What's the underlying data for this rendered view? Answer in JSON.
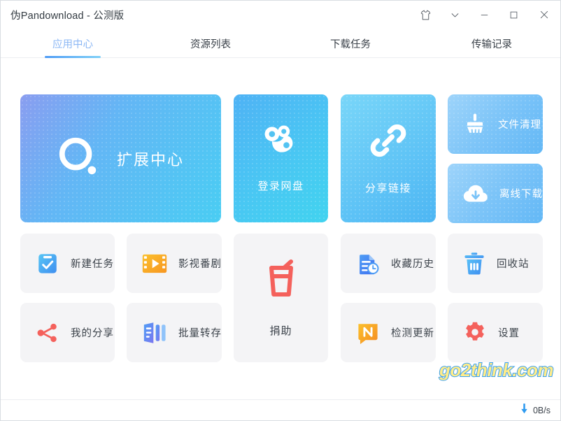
{
  "window": {
    "title": "伪Pandownload - 公测版",
    "controls": [
      {
        "name": "skin-icon",
        "label": "换肤"
      },
      {
        "name": "chevron-down-icon",
        "label": "更多"
      },
      {
        "name": "minimize-icon",
        "label": "最小化"
      },
      {
        "name": "maximize-icon",
        "label": "最大化"
      },
      {
        "name": "close-icon",
        "label": "关闭"
      }
    ]
  },
  "tabs": [
    {
      "label": "应用中心",
      "active": true
    },
    {
      "label": "资源列表",
      "active": false
    },
    {
      "label": "下载任务",
      "active": false
    },
    {
      "label": "传输记录",
      "active": false
    }
  ],
  "cards": {
    "extension_center": {
      "label": "扩展中心",
      "icon": "extension-ring-icon"
    },
    "login_netdisk": {
      "label": "登录网盘",
      "icon": "baidu-cloud-icon"
    },
    "share_link": {
      "label": "分享链接",
      "icon": "link-icon"
    },
    "file_clean": {
      "label": "文件清理",
      "icon": "broom-icon"
    },
    "offline_download": {
      "label": "离线下载",
      "icon": "cloud-download-icon"
    },
    "new_task": {
      "label": "新建任务",
      "icon": "clipboard-check-icon"
    },
    "movies_anime": {
      "label": "影视番剧",
      "icon": "film-play-icon"
    },
    "my_shares": {
      "label": "我的分享",
      "icon": "share-nodes-icon"
    },
    "batch_save": {
      "label": "批量转存",
      "icon": "batch-transfer-icon"
    },
    "donate": {
      "label": "捐助",
      "icon": "drink-cup-icon"
    },
    "favorites_history": {
      "label": "收藏历史",
      "icon": "doc-clock-icon"
    },
    "check_update": {
      "label": "检测更新",
      "icon": "n-badge-icon"
    },
    "recycle_bin": {
      "label": "回收站",
      "icon": "trash-icon"
    },
    "settings": {
      "label": "设置",
      "icon": "gear-icon"
    }
  },
  "statusbar": {
    "download_speed": "0B/s",
    "arrow_icon": "download-arrow-icon"
  },
  "watermark": {
    "text": "go2think.com"
  },
  "colors": {
    "accent_blue": "#4d9bf5",
    "tab_active": "#8db8f5",
    "card_grey": "#f4f4f6",
    "text_dark": "#3b424a",
    "red": "#f4615c",
    "orange": "#f5a623",
    "watermark_fill": "#ffec8a",
    "watermark_stroke": "#3aa0f0"
  }
}
